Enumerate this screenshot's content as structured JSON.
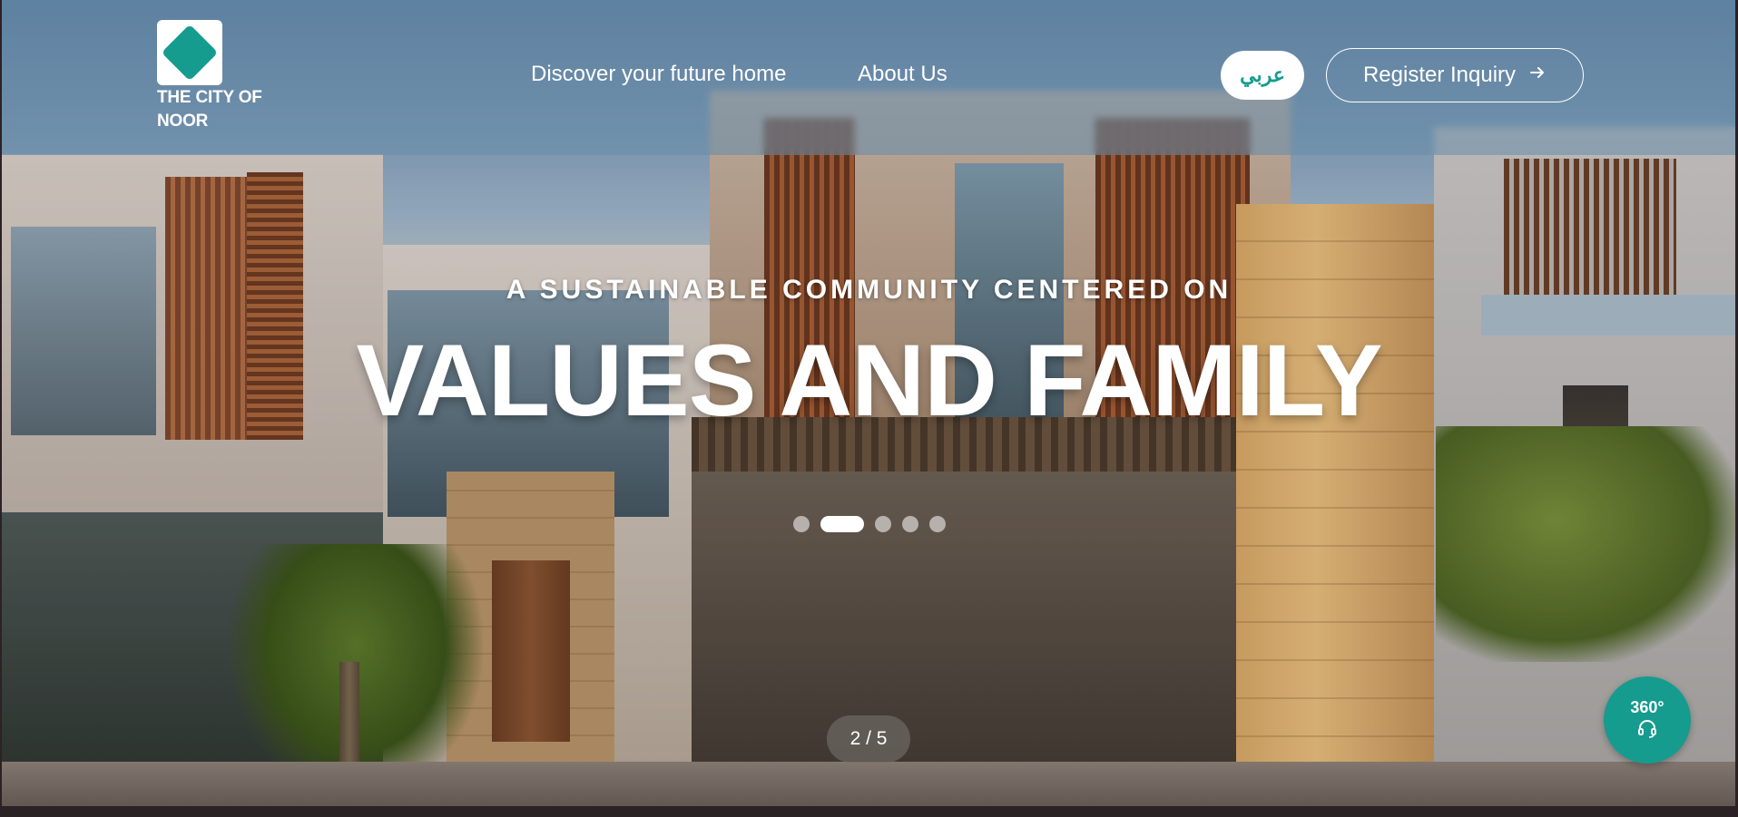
{
  "header": {
    "logo_text": "THE CITY OF NOOR",
    "nav": [
      {
        "label": "Discover your future home"
      },
      {
        "label": "About Us"
      }
    ],
    "language_label": "عربي",
    "register_label": "Register Inquiry",
    "register_icon": "arrow-right-icon"
  },
  "hero": {
    "subtitle": "A SUSTAINABLE COMMUNITY CENTERED ON",
    "title": "VALUES AND FAMILY",
    "slide_counter": "2 / 5",
    "slides_total": 5,
    "slide_active": 2
  },
  "tour_button": {
    "label": "360°",
    "icon": "headset-icon"
  },
  "colors": {
    "accent": "#169b8f",
    "header_overlay": "#668caa"
  }
}
